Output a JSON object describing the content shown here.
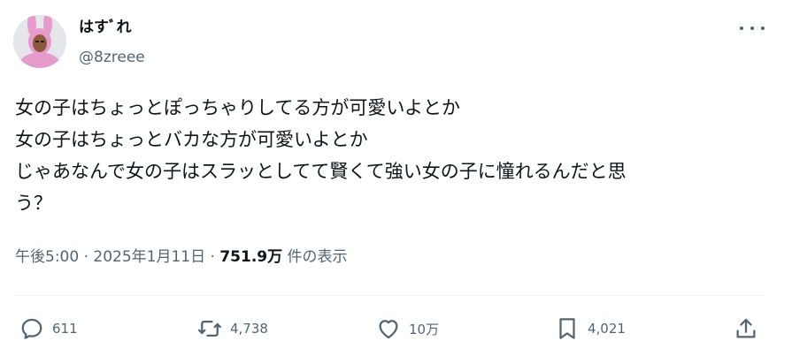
{
  "author": {
    "display_name": "はすﾞれ",
    "handle": "@8zreee"
  },
  "tweet": {
    "lines": [
      "女の子はちょっとぽっちゃりしてる方が可愛いよとか",
      "女の子はちょっとバカな方が可愛いよとか",
      "じゃあなんで女の子はスラッとしてて賢くて強い女の子に憧れるんだと思",
      "う？"
    ],
    "time": "午後5:00",
    "sep1": "·",
    "date": "2025年1月11日",
    "sep2": "·",
    "views": "751.9万",
    "views_label": "件の表示"
  },
  "actions": {
    "replies": "611",
    "reposts": "4,738",
    "likes": "10万",
    "bookmarks": "4,021"
  },
  "icons": {
    "avatar": "avatar-pink-bunny",
    "more": "more-horizontal-icon",
    "reply": "reply-icon",
    "repost": "repost-icon",
    "like": "heart-icon",
    "bookmark": "bookmark-icon",
    "share": "share-icon"
  },
  "colors": {
    "text": "#0f1419",
    "secondary": "#536471",
    "divider": "#eff3f4",
    "avatar_pink": "#e79bcd"
  }
}
